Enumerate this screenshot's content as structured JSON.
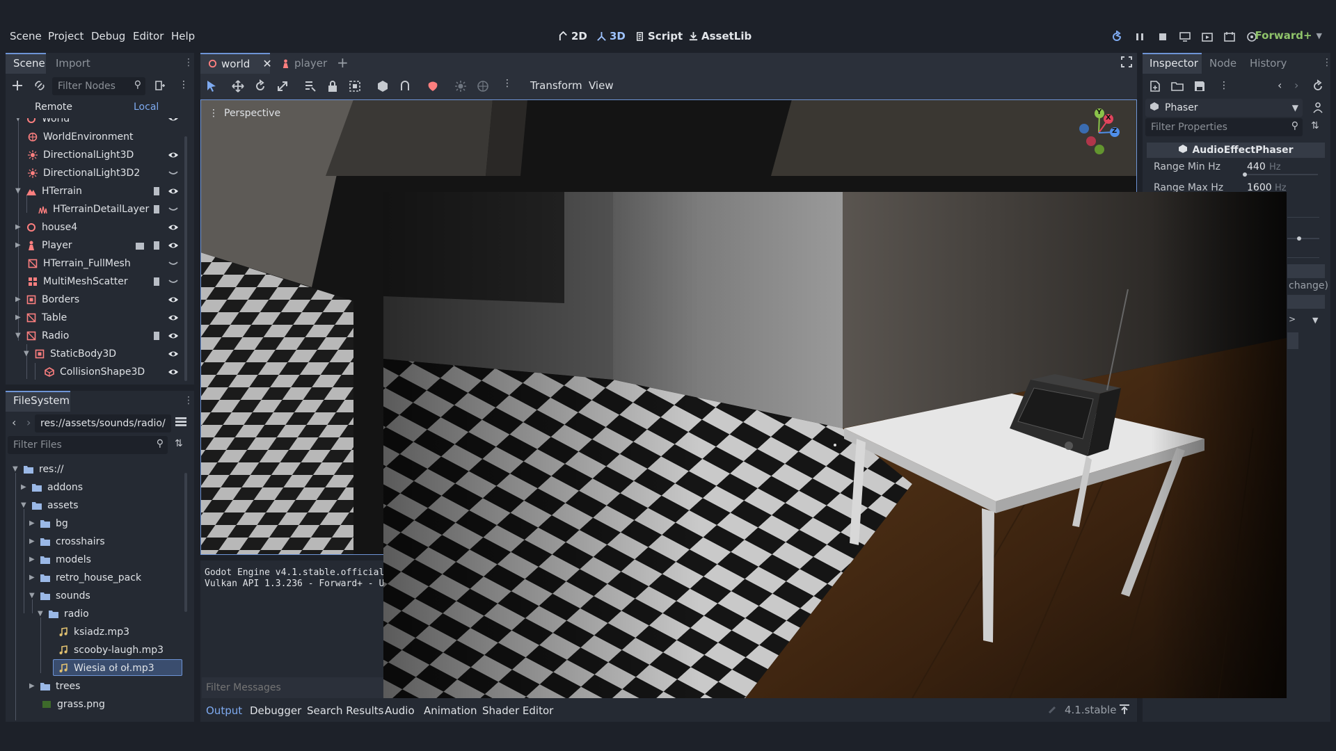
{
  "menubar": {
    "items": [
      "Scene",
      "Project",
      "Debug",
      "Editor",
      "Help"
    ],
    "main_buttons": [
      "2D",
      "3D",
      "Script",
      "AssetLib"
    ],
    "renderer": "Forward+"
  },
  "scene_panel": {
    "tabs": [
      "Scene",
      "Import"
    ],
    "filter_placeholder": "Filter Nodes",
    "remote_label": "Remote",
    "local_label": "Local",
    "nodes": [
      "World",
      "WorldEnvironment",
      "DirectionalLight3D",
      "DirectionalLight3D2",
      "HTerrain",
      "HTerrainDetailLayer",
      "house4",
      "Player",
      "HTerrain_FullMesh",
      "MultiMeshScatter",
      "Borders",
      "Table",
      "Radio",
      "StaticBody3D",
      "CollisionShape3D"
    ]
  },
  "filesystem": {
    "tab": "FileSystem",
    "path": "res://assets/sounds/radio/",
    "filter_placeholder": "Filter Files",
    "items": [
      "res://",
      "addons",
      "assets",
      "bg",
      "crosshairs",
      "models",
      "retro_house_pack",
      "sounds",
      "radio",
      "ksiadz.mp3",
      "scooby-laugh.mp3",
      "Wiesia oł oł.mp3",
      "trees",
      "grass.png"
    ]
  },
  "editor_tabs": [
    "world",
    "player"
  ],
  "toolbar": {
    "transform": "Transform",
    "view": "View"
  },
  "viewport": {
    "perspective_label": "Perspective",
    "gizmo_axes": [
      "Y",
      "X",
      "Z"
    ]
  },
  "output": {
    "lines": [
      "Godot Engine v4.1.stable.official",
      "Vulkan API 1.3.236 - Forward+ - U"
    ],
    "filter_placeholder": "Filter Messages",
    "bottom_tabs": [
      "Output",
      "Debugger",
      "Search Results",
      "Audio",
      "Animation",
      "Shader Editor"
    ],
    "version": "4.1.stable"
  },
  "inspector": {
    "tabs": [
      "Inspector",
      "Node",
      "History"
    ],
    "resource_name": "Phaser",
    "filter_placeholder": "Filter Properties",
    "class_name": "AudioEffectPhaser",
    "properties": [
      {
        "label": "Range Min Hz",
        "value": "440",
        "unit": "Hz"
      },
      {
        "label": "Range Max Hz",
        "value": "1600",
        "unit": "Hz"
      }
    ],
    "partial_text": "change)"
  },
  "colors": {
    "accent": "#6e94d6",
    "renderer": "#8fc36a",
    "node_red": "#fc7f7f"
  }
}
